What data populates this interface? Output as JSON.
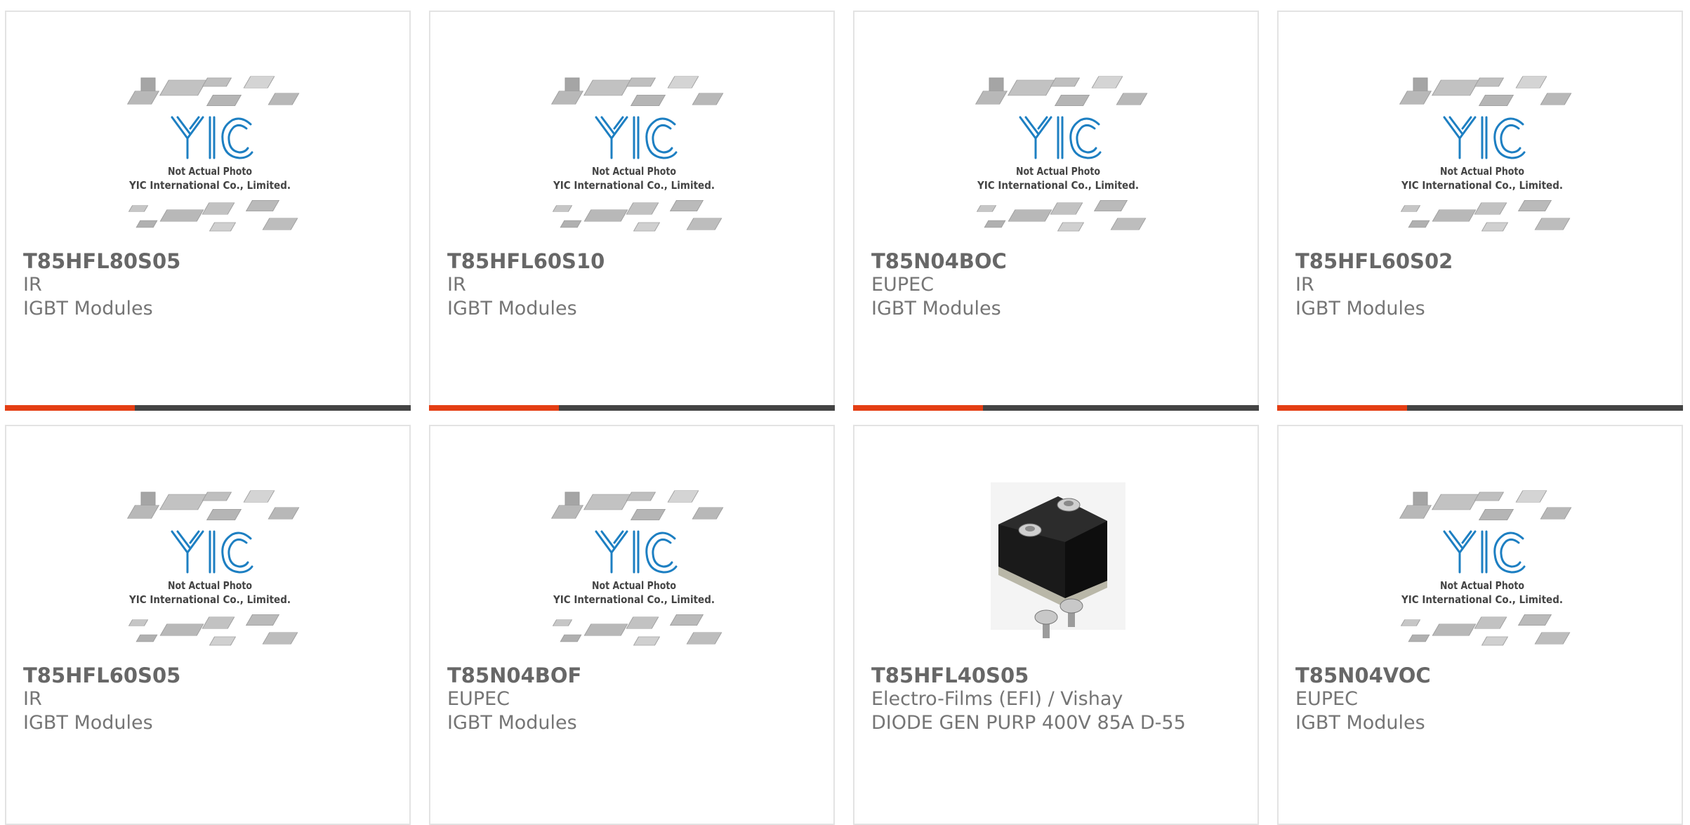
{
  "placeholder_image": {
    "logo_text": "YIC",
    "line1": "Not Actual Photo",
    "line2": "YIC International Co., Limited."
  },
  "colors": {
    "accent_bar": "#e43e14",
    "bar_dark": "#444444",
    "logo_blue": "#1d7fc2",
    "card_border": "#e3e3e3"
  },
  "products": [
    {
      "part_no": "T85HFL80S05",
      "maker": "IR",
      "category": "IGBT Modules",
      "image": "placeholder"
    },
    {
      "part_no": "T85HFL60S10",
      "maker": "IR",
      "category": "IGBT Modules",
      "image": "placeholder"
    },
    {
      "part_no": "T85N04BOC",
      "maker": "EUPEC",
      "category": "IGBT Modules",
      "image": "placeholder"
    },
    {
      "part_no": "T85HFL60S02",
      "maker": "IR",
      "category": "IGBT Modules",
      "image": "placeholder"
    },
    {
      "part_no": "T85HFL60S05",
      "maker": "IR",
      "category": "IGBT Modules",
      "image": "placeholder"
    },
    {
      "part_no": "T85N04BOF",
      "maker": "EUPEC",
      "category": "IGBT Modules",
      "image": "placeholder"
    },
    {
      "part_no": "T85HFL40S05",
      "maker": "Electro-Films (EFI) / Vishay",
      "category": "DIODE GEN PURP 400V 85A D-55",
      "image": "module-photo"
    },
    {
      "part_no": "T85N04VOC",
      "maker": "EUPEC",
      "category": "IGBT Modules",
      "image": "placeholder"
    }
  ]
}
